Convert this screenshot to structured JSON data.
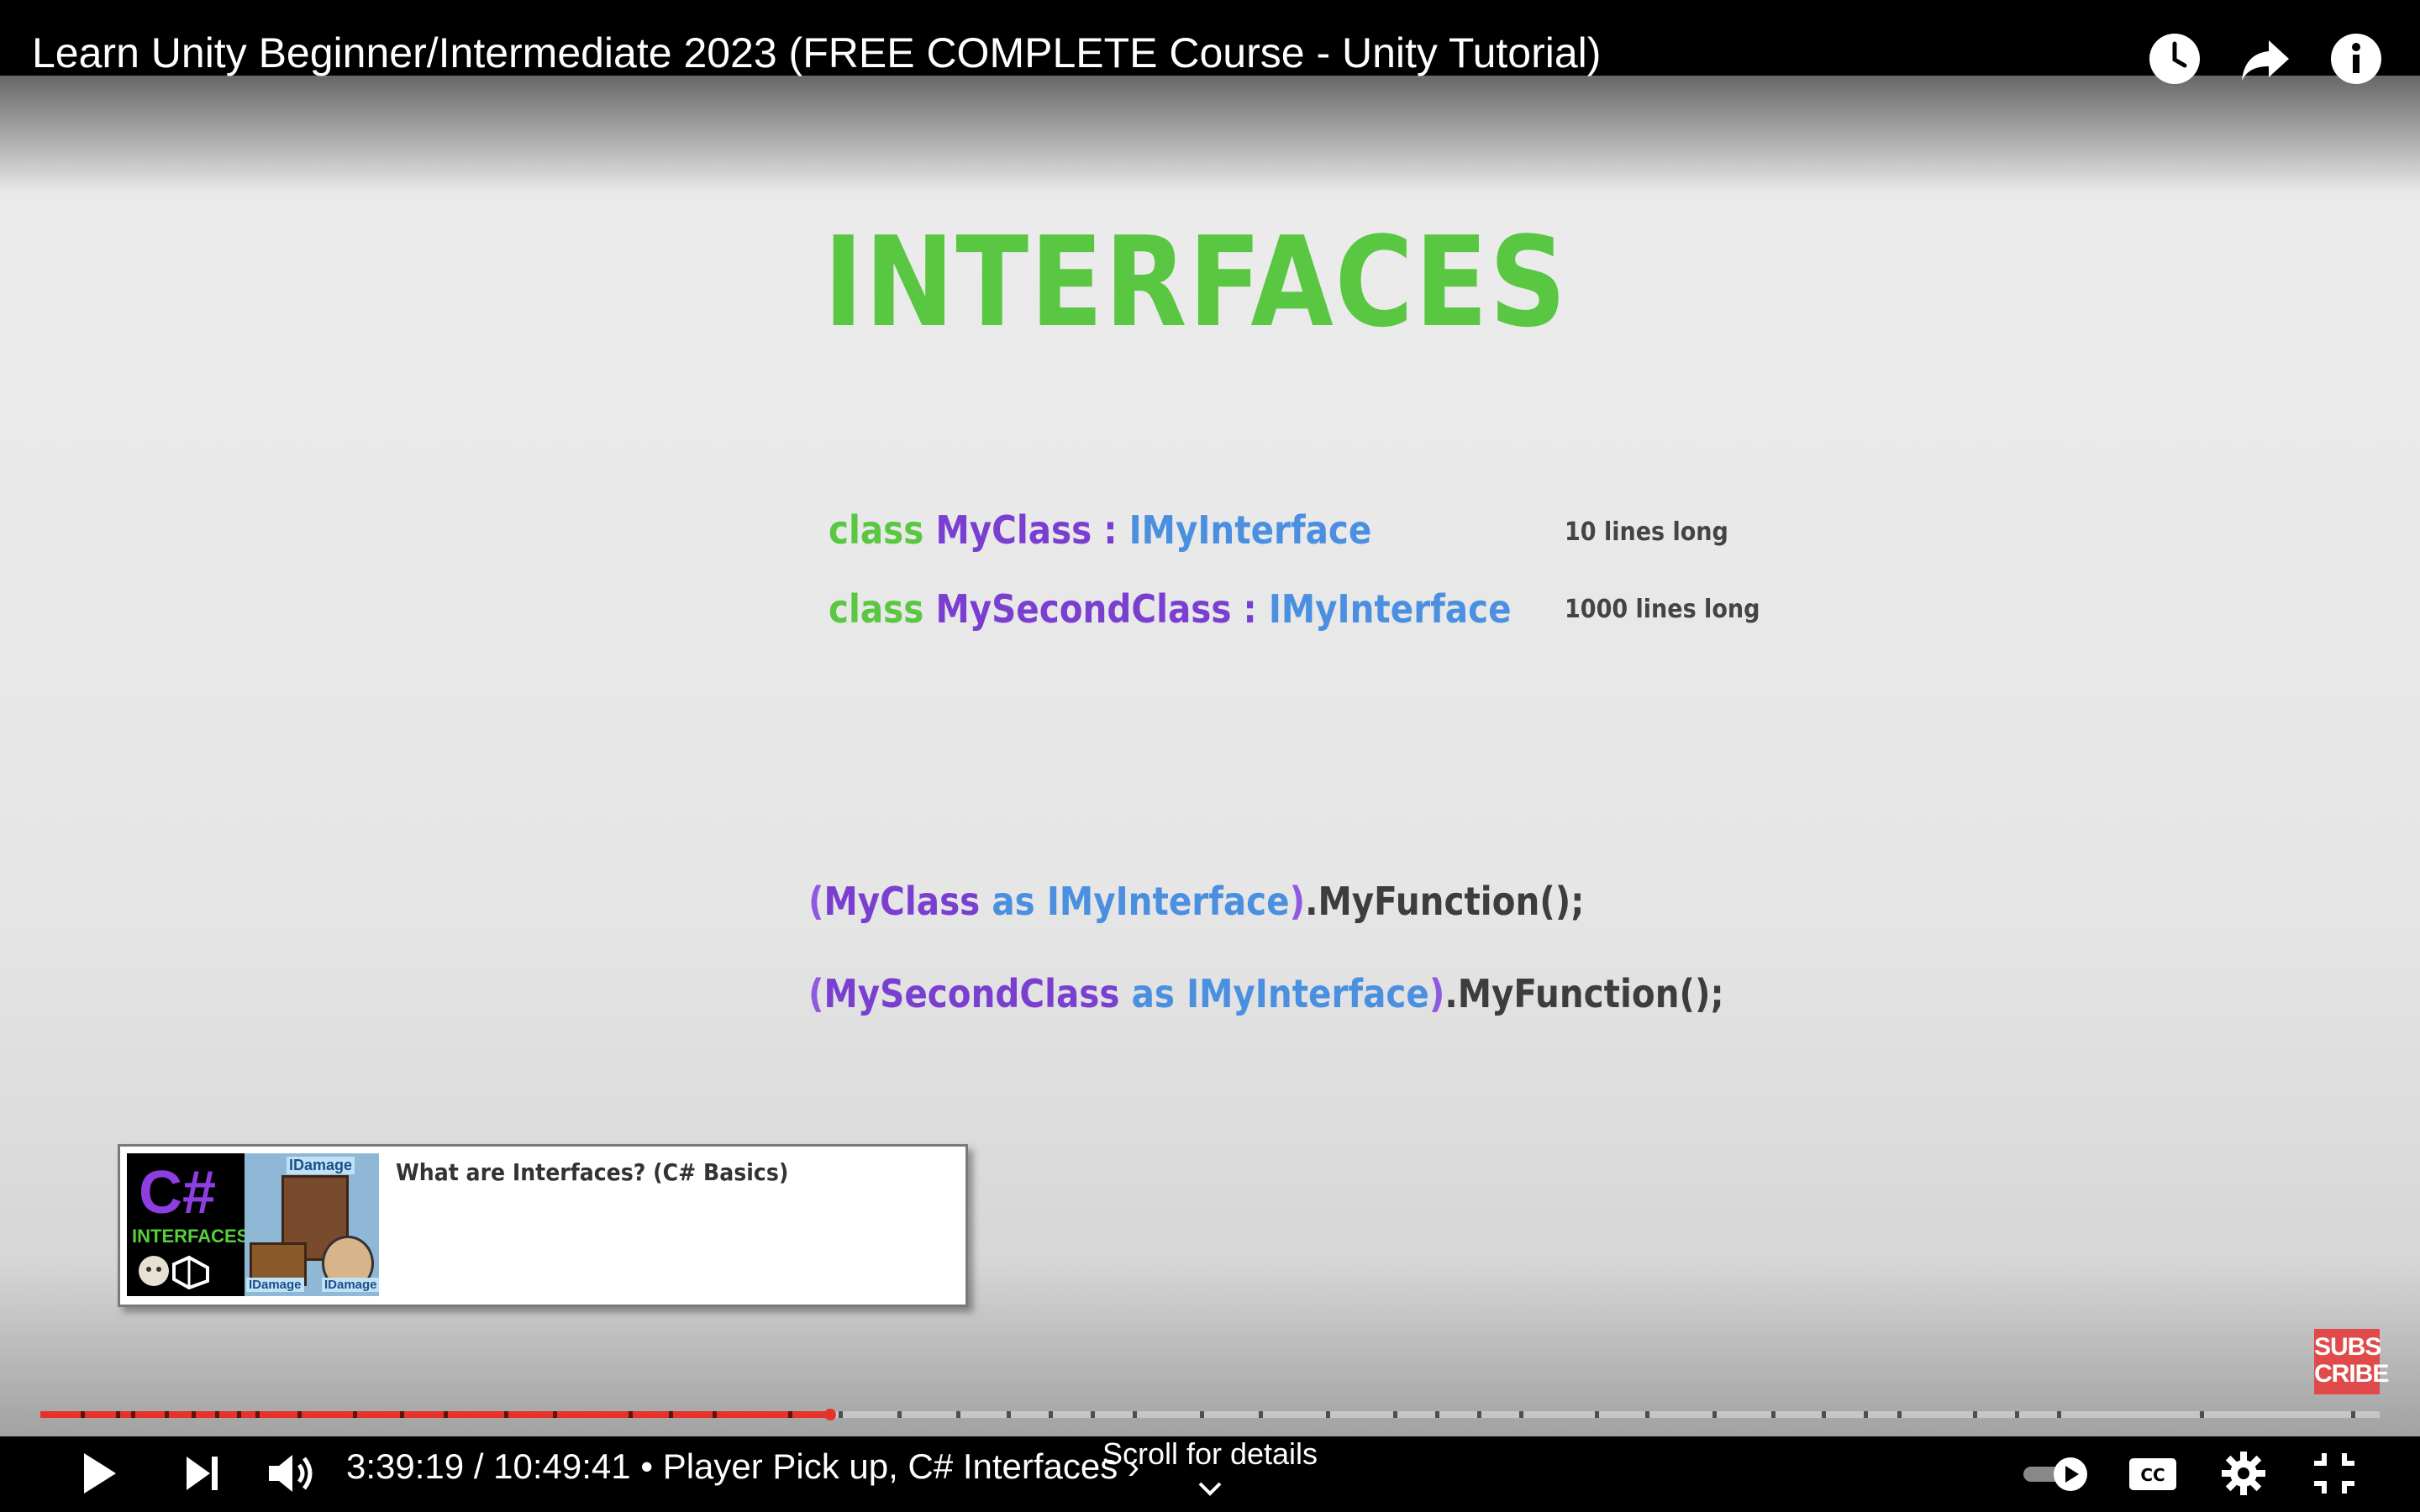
{
  "window": {
    "title": "Learn Unity Beginner/Intermediate 2023 (FREE COMPLETE Course - Unity Tutorial)"
  },
  "top_icons": [
    "watch-later-icon",
    "share-icon",
    "info-icon"
  ],
  "slide": {
    "title": "INTERFACES",
    "line1": {
      "kw": "class",
      "name": "MyClass :",
      "iface": "IMyInterface",
      "note": "10 lines long"
    },
    "line2": {
      "kw": "class",
      "name": "MySecondClass :",
      "iface": "IMyInterface",
      "note": "1000 lines long"
    },
    "call1": {
      "open": "(",
      "name": "MyClass",
      "as": "as",
      "iface": "IMyInterface",
      "close": ")",
      "func": ".MyFunction();"
    },
    "call2": {
      "open": "(",
      "name": "MySecondClass",
      "as": "as",
      "iface": "IMyInterface",
      "close": ")",
      "func": ".MyFunction();"
    }
  },
  "card": {
    "title": "What are Interfaces? (C# Basics)",
    "thumb_main": "C#",
    "thumb_label": "INTERFACES",
    "thumb_tag": "IDamage"
  },
  "subscribe": {
    "line1": "SUBS",
    "line2": "CRIBE"
  },
  "player": {
    "current_time": "3:39:19",
    "separator": "/",
    "duration": "10:49:41",
    "chapter": "• Player Pick up, C# Interfaces",
    "chapter_arrow": "›",
    "scroll_hint": "Scroll for details",
    "progress_fraction": 0.3375,
    "accent_color": "#e5322b"
  },
  "controls": [
    "play-icon",
    "next-icon",
    "volume-icon",
    "autoplay-toggle",
    "captions-icon",
    "settings-icon",
    "exit-fullscreen-icon"
  ]
}
